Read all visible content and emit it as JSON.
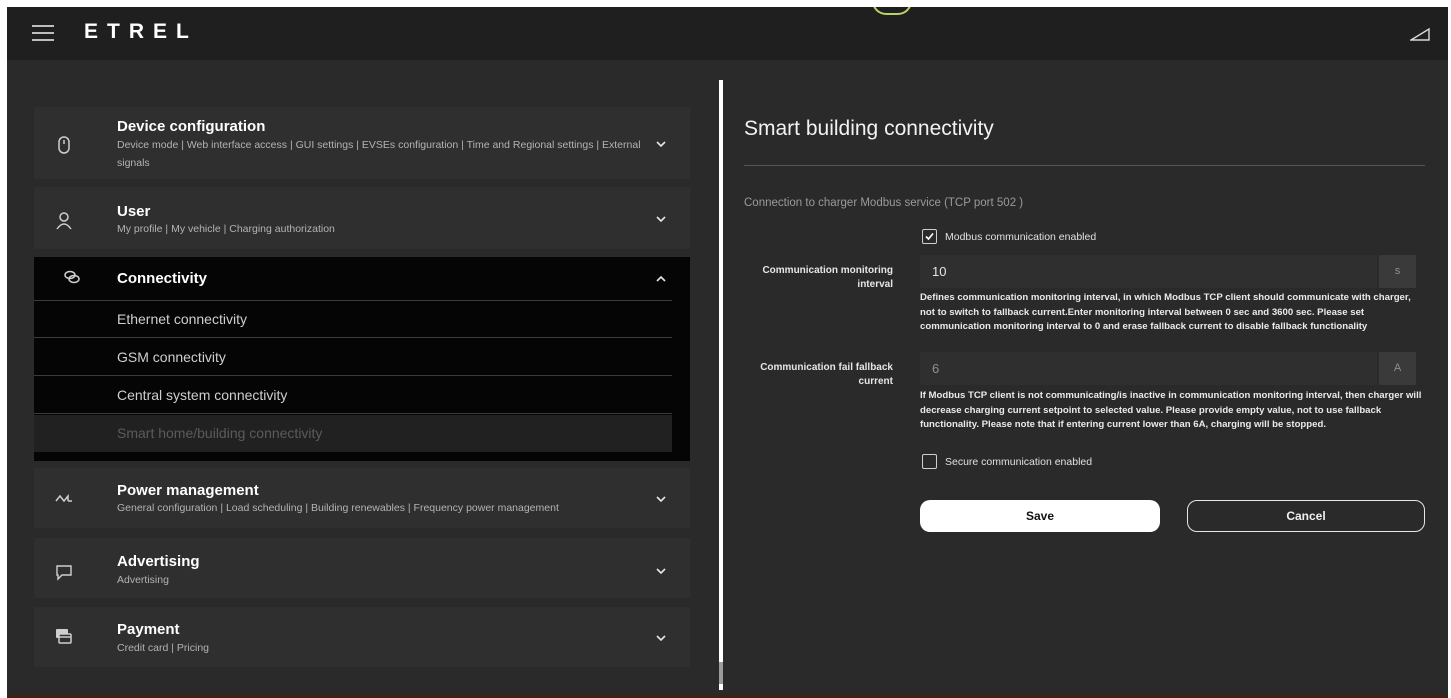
{
  "header": {
    "logo": "ETREL"
  },
  "menu": {
    "device_configuration": {
      "title": "Device configuration",
      "subtitle": "Device mode  |  Web interface access  |  GUI settings  |  EVSEs configuration  |  Time and Regional settings  |  External signals"
    },
    "user": {
      "title": "User",
      "subtitle": "My profile  |  My vehicle  |  Charging authorization"
    },
    "connectivity": {
      "title": "Connectivity",
      "items": [
        "Ethernet connectivity",
        "GSM connectivity",
        "Central system connectivity",
        "Smart home/building connectivity"
      ]
    },
    "power_management": {
      "title": "Power management",
      "subtitle": "General configuration  |  Load scheduling  |  Building renewables  |  Frequency power management"
    },
    "advertising": {
      "title": "Advertising",
      "subtitle": "Advertising"
    },
    "payment": {
      "title": "Payment",
      "subtitle": "Credit card  |  Pricing"
    }
  },
  "form": {
    "title": "Smart building connectivity",
    "section": "Connection to charger Modbus service (TCP port 502 )",
    "modbus_enabled_label": "Modbus communication enabled",
    "modbus_enabled": true,
    "monitoring": {
      "label": "Communication monitoring interval",
      "value": "10",
      "unit": "s",
      "help": "Defines communication monitoring interval, in which Modbus TCP client should communicate with charger, not to switch to fallback current.Enter monitoring interval between 0 sec and 3600 sec. Please set communication monitoring interval to 0 and erase fallback current to disable fallback functionality"
    },
    "fallback": {
      "label": "Communication fail fallback current",
      "value": "6",
      "unit": "A",
      "help": "If Modbus TCP client is not communicating/is inactive in communication monitoring interval, then charger will decrease charging current setpoint to selected value. Please provide empty value, not to use fallback functionality. Please note that if entering current lower than 6A, charging will be stopped."
    },
    "secure_label": "Secure communication enabled",
    "secure_enabled": false,
    "save_label": "Save",
    "cancel_label": "Cancel"
  },
  "colors": {
    "background": "#2a2a2a",
    "topbar": "#1f1f1f",
    "active_block": "#050505"
  },
  "icons": {
    "device": "mouse-icon",
    "user": "user-icon",
    "connectivity": "link-icon",
    "power": "power-wave-icon",
    "advertising": "message-icon",
    "payment": "cards-icon"
  }
}
